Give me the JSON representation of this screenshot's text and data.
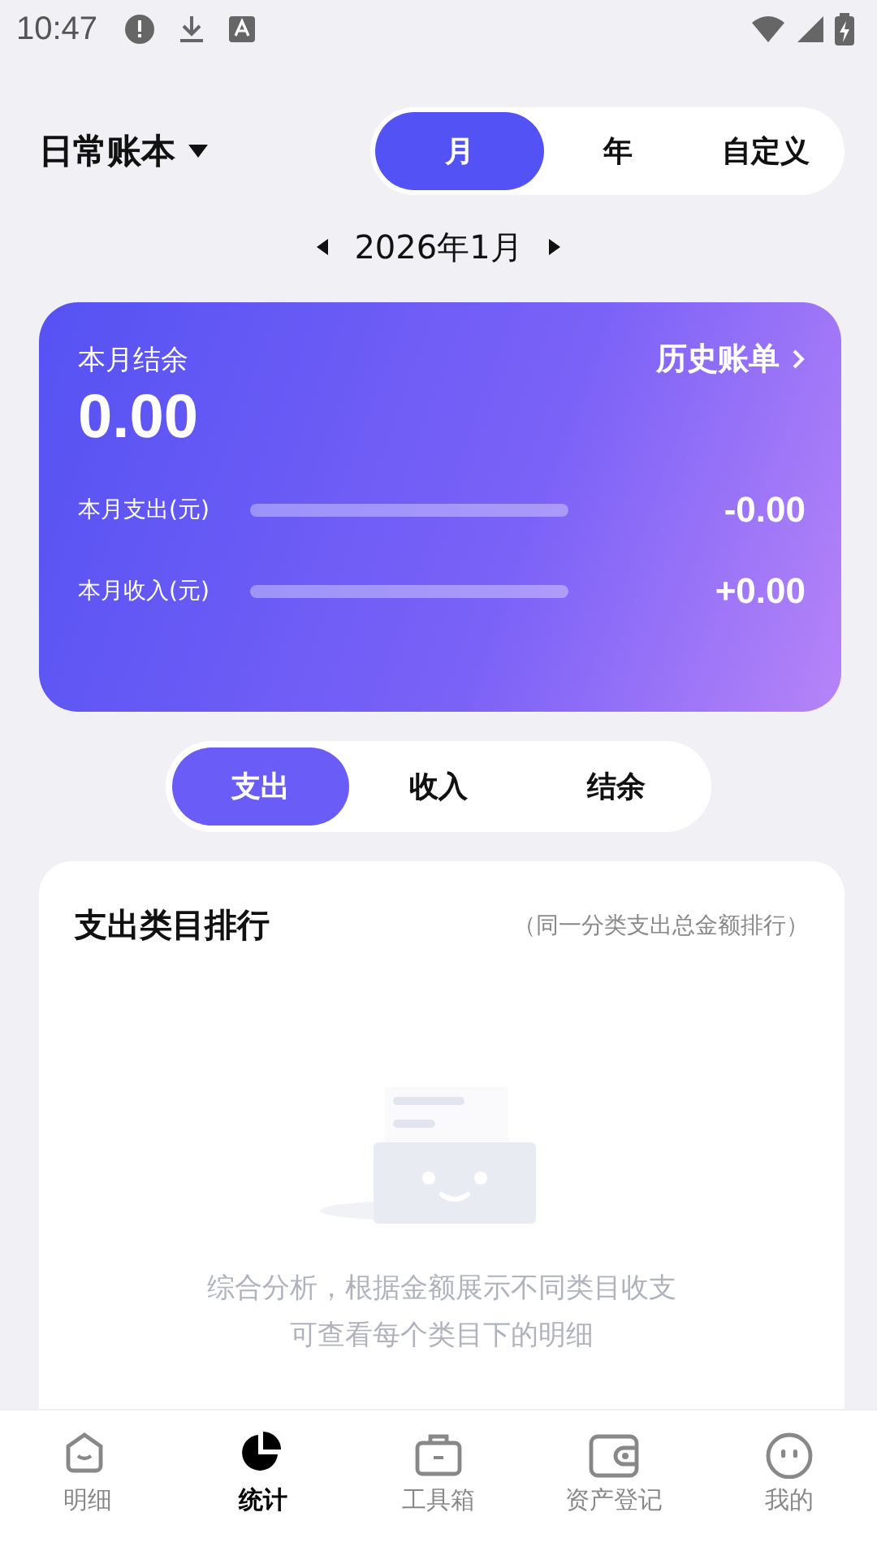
{
  "status_bar": {
    "time": "10:47"
  },
  "header": {
    "book": "日常账本",
    "periods": [
      {
        "label": "月",
        "selected": true
      },
      {
        "label": "年",
        "selected": false
      },
      {
        "label": "自定义",
        "selected": false
      }
    ]
  },
  "date_nav": {
    "label": "2026年1月"
  },
  "summary": {
    "title": "本月结余",
    "balance": "0.00",
    "history_link": "历史账单",
    "rows": [
      {
        "label": "本月支出(元)",
        "level": 0,
        "value": "-0.00"
      },
      {
        "label": "本月收入(元)",
        "level": 0,
        "value": "+0.00"
      }
    ]
  },
  "type_tabs": [
    {
      "label": "支出",
      "selected": true
    },
    {
      "label": "收入",
      "selected": false
    },
    {
      "label": "结余",
      "selected": false
    }
  ],
  "ranking": {
    "title": "支出类目排行",
    "note": "（同一分类支出总金额排行）",
    "empty_lines": [
      "综合分析，根据金额展示不同类目收支",
      "可查看每个类目下的明细"
    ]
  },
  "bottom_nav": [
    {
      "kind": "home",
      "label": "明细",
      "selected": false
    },
    {
      "kind": "pie",
      "label": "统计",
      "selected": true
    },
    {
      "kind": "toolbox",
      "label": "工具箱",
      "selected": false
    },
    {
      "kind": "wallet",
      "label": "资产登记",
      "selected": false
    },
    {
      "kind": "face",
      "label": "我的",
      "selected": false
    }
  ]
}
